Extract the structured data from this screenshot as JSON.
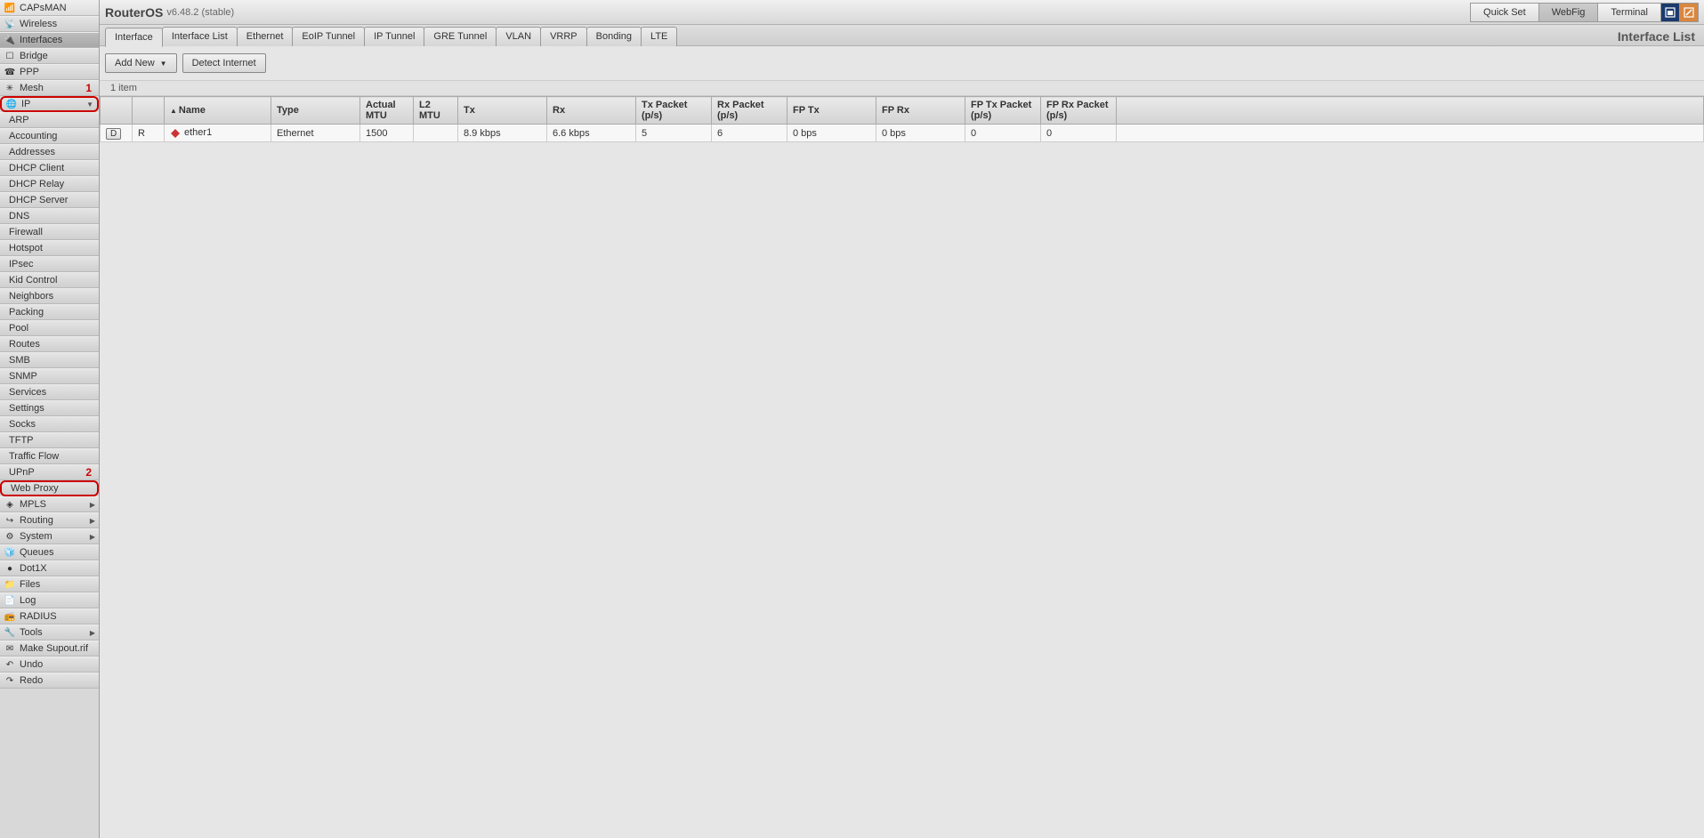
{
  "brand": {
    "name": "RouterOS",
    "version": "v6.48.2 (stable)"
  },
  "top_buttons": {
    "quick_set": "Quick Set",
    "webfig": "WebFig",
    "terminal": "Terminal"
  },
  "sidebar": {
    "items": [
      {
        "label": "CAPsMAN",
        "icon": "📶",
        "active": false,
        "sub": false,
        "expand": false
      },
      {
        "label": "Wireless",
        "icon": "📡",
        "active": false,
        "sub": false,
        "expand": false
      },
      {
        "label": "Interfaces",
        "icon": "🔌",
        "active": true,
        "sub": false,
        "expand": false
      },
      {
        "label": "Bridge",
        "icon": "☐",
        "active": false,
        "sub": false,
        "expand": false
      },
      {
        "label": "PPP",
        "icon": "☎",
        "active": false,
        "sub": false,
        "expand": false
      },
      {
        "label": "Mesh",
        "icon": "✳",
        "active": false,
        "sub": false,
        "expand": false,
        "marker": "1"
      },
      {
        "label": "IP",
        "icon": "🌐",
        "active": false,
        "sub": false,
        "expand": true,
        "highlight": true,
        "arrow": "▼"
      },
      {
        "label": "ARP",
        "icon": "",
        "active": false,
        "sub": true,
        "expand": false
      },
      {
        "label": "Accounting",
        "icon": "",
        "active": false,
        "sub": true,
        "expand": false
      },
      {
        "label": "Addresses",
        "icon": "",
        "active": false,
        "sub": true,
        "expand": false
      },
      {
        "label": "DHCP Client",
        "icon": "",
        "active": false,
        "sub": true,
        "expand": false
      },
      {
        "label": "DHCP Relay",
        "icon": "",
        "active": false,
        "sub": true,
        "expand": false
      },
      {
        "label": "DHCP Server",
        "icon": "",
        "active": false,
        "sub": true,
        "expand": false
      },
      {
        "label": "DNS",
        "icon": "",
        "active": false,
        "sub": true,
        "expand": false
      },
      {
        "label": "Firewall",
        "icon": "",
        "active": false,
        "sub": true,
        "expand": false
      },
      {
        "label": "Hotspot",
        "icon": "",
        "active": false,
        "sub": true,
        "expand": false
      },
      {
        "label": "IPsec",
        "icon": "",
        "active": false,
        "sub": true,
        "expand": false
      },
      {
        "label": "Kid Control",
        "icon": "",
        "active": false,
        "sub": true,
        "expand": false
      },
      {
        "label": "Neighbors",
        "icon": "",
        "active": false,
        "sub": true,
        "expand": false
      },
      {
        "label": "Packing",
        "icon": "",
        "active": false,
        "sub": true,
        "expand": false
      },
      {
        "label": "Pool",
        "icon": "",
        "active": false,
        "sub": true,
        "expand": false
      },
      {
        "label": "Routes",
        "icon": "",
        "active": false,
        "sub": true,
        "expand": false
      },
      {
        "label": "SMB",
        "icon": "",
        "active": false,
        "sub": true,
        "expand": false
      },
      {
        "label": "SNMP",
        "icon": "",
        "active": false,
        "sub": true,
        "expand": false
      },
      {
        "label": "Services",
        "icon": "",
        "active": false,
        "sub": true,
        "expand": false
      },
      {
        "label": "Settings",
        "icon": "",
        "active": false,
        "sub": true,
        "expand": false
      },
      {
        "label": "Socks",
        "icon": "",
        "active": false,
        "sub": true,
        "expand": false
      },
      {
        "label": "TFTP",
        "icon": "",
        "active": false,
        "sub": true,
        "expand": false
      },
      {
        "label": "Traffic Flow",
        "icon": "",
        "active": false,
        "sub": true,
        "expand": false
      },
      {
        "label": "UPnP",
        "icon": "",
        "active": false,
        "sub": true,
        "expand": false,
        "marker": "2"
      },
      {
        "label": "Web Proxy",
        "icon": "",
        "active": false,
        "sub": true,
        "expand": false,
        "highlight": true
      },
      {
        "label": "MPLS",
        "icon": "◈",
        "active": false,
        "sub": false,
        "expand": true,
        "arrow": "▶"
      },
      {
        "label": "Routing",
        "icon": "↪",
        "active": false,
        "sub": false,
        "expand": true,
        "arrow": "▶"
      },
      {
        "label": "System",
        "icon": "⚙",
        "active": false,
        "sub": false,
        "expand": true,
        "arrow": "▶"
      },
      {
        "label": "Queues",
        "icon": "🧊",
        "active": false,
        "sub": false,
        "expand": false
      },
      {
        "label": "Dot1X",
        "icon": "●",
        "active": false,
        "sub": false,
        "expand": false
      },
      {
        "label": "Files",
        "icon": "📁",
        "active": false,
        "sub": false,
        "expand": false
      },
      {
        "label": "Log",
        "icon": "📄",
        "active": false,
        "sub": false,
        "expand": false
      },
      {
        "label": "RADIUS",
        "icon": "📻",
        "active": false,
        "sub": false,
        "expand": false
      },
      {
        "label": "Tools",
        "icon": "🔧",
        "active": false,
        "sub": false,
        "expand": true,
        "arrow": "▶"
      },
      {
        "label": "Make Supout.rif",
        "icon": "✉",
        "active": false,
        "sub": false,
        "expand": false
      },
      {
        "label": "Undo",
        "icon": "↶",
        "active": false,
        "sub": false,
        "expand": false
      },
      {
        "label": "Redo",
        "icon": "↷",
        "active": false,
        "sub": false,
        "expand": false
      }
    ]
  },
  "tabs": {
    "items": [
      {
        "label": "Interface",
        "active": true
      },
      {
        "label": "Interface List",
        "active": false
      },
      {
        "label": "Ethernet",
        "active": false
      },
      {
        "label": "EoIP Tunnel",
        "active": false
      },
      {
        "label": "IP Tunnel",
        "active": false
      },
      {
        "label": "GRE Tunnel",
        "active": false
      },
      {
        "label": "VLAN",
        "active": false
      },
      {
        "label": "VRRP",
        "active": false
      },
      {
        "label": "Bonding",
        "active": false
      },
      {
        "label": "LTE",
        "active": false
      }
    ],
    "page_title": "Interface List"
  },
  "toolbar": {
    "add_new": "Add New",
    "detect": "Detect Internet"
  },
  "count_bar": "1 item",
  "table": {
    "headers": {
      "col1": "",
      "col2": "",
      "name": "Name",
      "type": "Type",
      "actual_mtu": "Actual MTU",
      "l2_mtu": "L2 MTU",
      "tx": "Tx",
      "rx": "Rx",
      "tx_pkt": "Tx Packet (p/s)",
      "rx_pkt": "Rx Packet (p/s)",
      "fp_tx": "FP Tx",
      "fp_rx": "FP Rx",
      "fp_tx_pkt": "FP Tx Packet (p/s)",
      "fp_rx_pkt": "FP Rx Packet (p/s)",
      "blank": ""
    },
    "rows": [
      {
        "btn": "D",
        "flag": "R",
        "name": "ether1",
        "type": "Ethernet",
        "actual_mtu": "1500",
        "l2_mtu": "",
        "tx": "8.9 kbps",
        "rx": "6.6 kbps",
        "tx_pkt": "5",
        "rx_pkt": "6",
        "fp_tx": "0 bps",
        "fp_rx": "0 bps",
        "fp_tx_pkt": "0",
        "fp_rx_pkt": "0"
      }
    ]
  }
}
